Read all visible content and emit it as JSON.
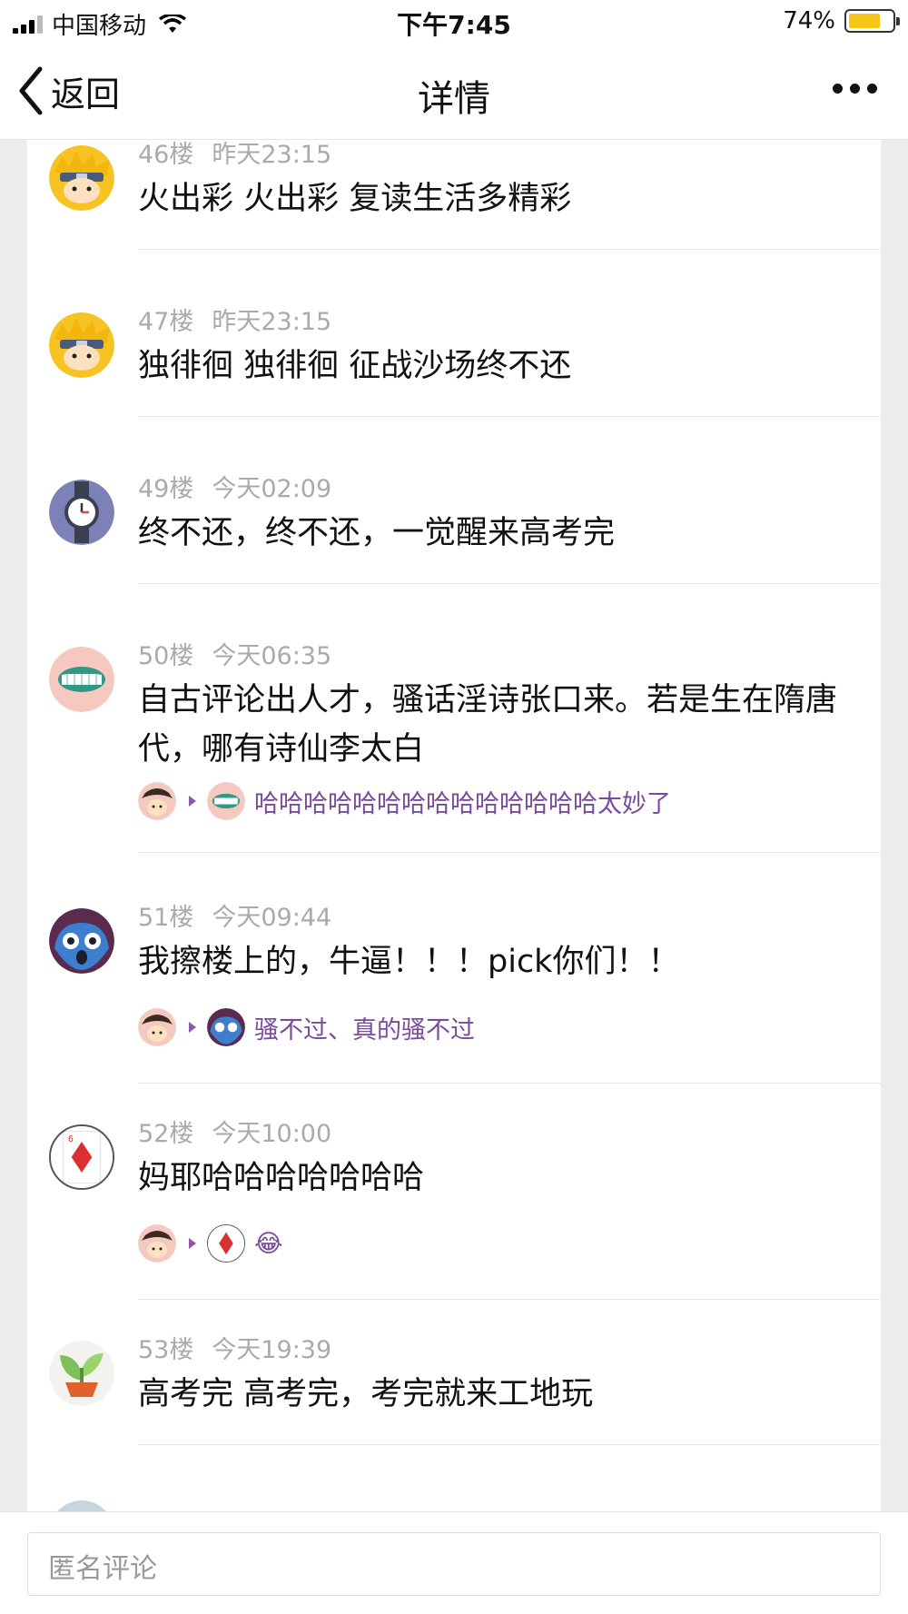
{
  "status": {
    "carrier": "中国移动",
    "time": "下午7:45",
    "battery": "74%",
    "battery_level": 0.74
  },
  "nav": {
    "back_label": "返回",
    "title": "详情"
  },
  "comments": [
    {
      "floor": "46楼",
      "time": "昨天23:15",
      "text": "火出彩 火出彩 复读生活多精彩",
      "avatar": "naruto-avatar-icon"
    },
    {
      "floor": "47楼",
      "time": "昨天23:15",
      "text": "独徘徊 独徘徊 征战沙场终不还",
      "avatar": "naruto-avatar-icon"
    },
    {
      "floor": "49楼",
      "time": "今天02:09",
      "text": "终不还，终不还，一觉醒来高考完",
      "avatar": "clock-avatar-icon"
    },
    {
      "floor": "50楼",
      "time": "今天06:35",
      "text": "自古评论出人才，骚话淫诗张口来。若是生在隋唐代，哪有诗仙李太白",
      "avatar": "smile-avatar-icon",
      "reply": "哈哈哈哈哈哈哈哈哈哈哈哈哈哈太妙了"
    },
    {
      "floor": "51楼",
      "time": "今天09:44",
      "text": "我擦楼上的，牛逼！！！pick你们！！",
      "avatar": "monster-avatar-icon",
      "reply": "骚不过、真的骚不过"
    },
    {
      "floor": "52楼",
      "time": "今天10:00",
      "text": "妈耶哈哈哈哈哈哈哈",
      "avatar": "card-avatar-icon",
      "reply": "😂"
    },
    {
      "floor": "53楼",
      "time": "今天19:39",
      "text": "高考完 高考完，考完就来工地玩",
      "avatar": "plant-avatar-icon"
    }
  ],
  "input": {
    "placeholder": "匿名评论"
  }
}
